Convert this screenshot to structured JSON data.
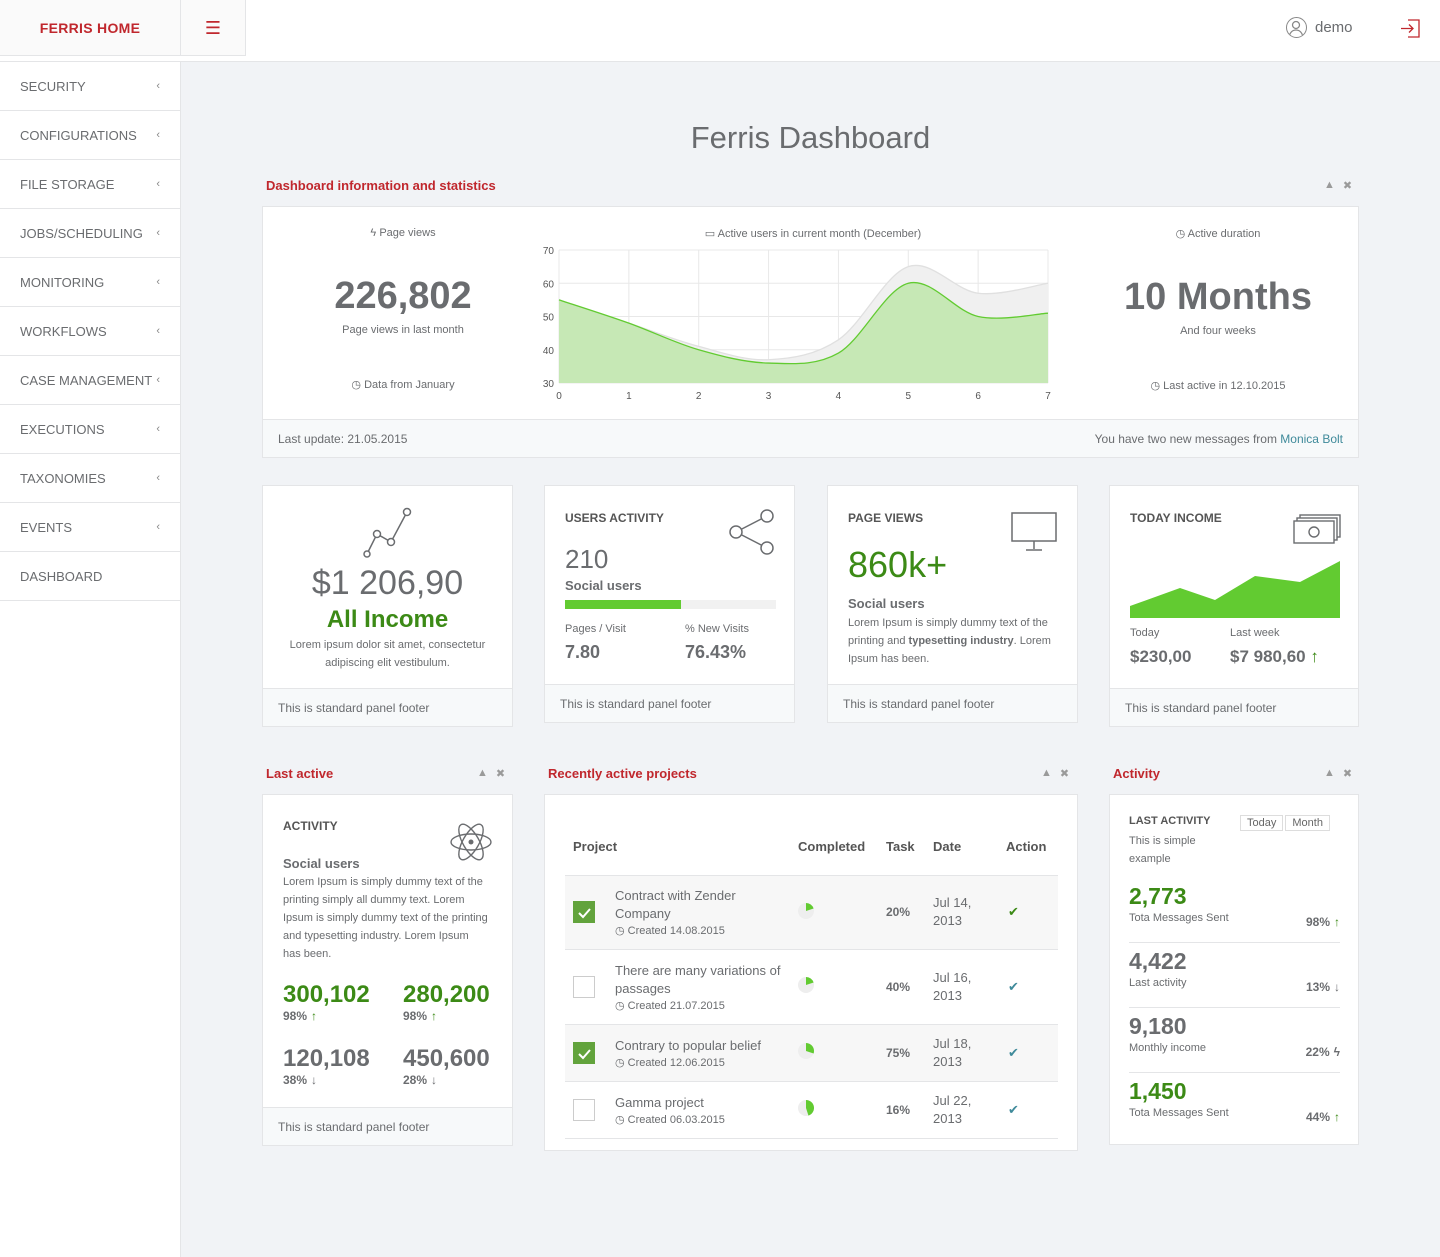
{
  "brand": "FERRIS HOME",
  "user": {
    "name": "demo"
  },
  "sidebar": {
    "items": [
      {
        "label": "SECURITY",
        "chevron": "‹"
      },
      {
        "label": "CONFIGURATIONS",
        "chevron": "‹"
      },
      {
        "label": "FILE STORAGE",
        "chevron": "‹"
      },
      {
        "label": "JOBS/SCHEDULING",
        "chevron": "‹"
      },
      {
        "label": "MONITORING",
        "chevron": "‹"
      },
      {
        "label": "WORKFLOWS",
        "chevron": "‹"
      },
      {
        "label": "CASE MANAGEMENT",
        "chevron": "‹"
      },
      {
        "label": "EXECUTIONS",
        "chevron": "‹"
      },
      {
        "label": "TAXONOMIES",
        "chevron": "‹"
      },
      {
        "label": "EVENTS",
        "chevron": "‹"
      },
      {
        "label": "DASHBOARD",
        "chevron": ""
      }
    ]
  },
  "page_title": "Ferris Dashboard",
  "stats": {
    "title": "Dashboard information and statistics",
    "page_views": {
      "heading": "Page views",
      "value": "226,802",
      "caption": "Page views in last month",
      "note": "Data from January"
    },
    "chart_heading": "Active users in current month (December)",
    "duration": {
      "heading": "Active duration",
      "value": "10 Months",
      "caption": "And four weeks",
      "note": "Last active in 12.10.2015"
    },
    "footer_left": "Last update: 21.05.2015",
    "footer_right": "You have two new messages from",
    "footer_link": "Monica Bolt"
  },
  "chart_data": {
    "type": "area",
    "x": [
      0,
      1,
      2,
      3,
      4,
      5,
      6,
      7
    ],
    "xlim": [
      0,
      7
    ],
    "ylim": [
      30,
      70
    ],
    "yticks": [
      30,
      40,
      50,
      60,
      70
    ],
    "grid": true,
    "series": [
      {
        "values": [
          55,
          48,
          41,
          37,
          43,
          65,
          57,
          60
        ],
        "color": "#f0f0f0"
      },
      {
        "values": [
          55,
          48,
          40,
          36,
          39,
          60,
          50,
          51
        ],
        "color": "#62cb31"
      }
    ]
  },
  "cards": {
    "income": {
      "value": "$1 206,90",
      "label": "All Income",
      "desc": "Lorem ipsum dolor sit amet, consectetur adipiscing elit vestibulum.",
      "footer": "This is standard panel footer"
    },
    "users_activity": {
      "title": "USERS ACTIVITY",
      "value": "210",
      "sub": "Social users",
      "progress": 0.55,
      "stat1_label": "Pages / Visit",
      "stat1_value": "7.80",
      "stat2_label": "% New Visits",
      "stat2_value": "76.43%",
      "footer": "This is standard panel footer"
    },
    "page_views": {
      "title": "PAGE VIEWS",
      "value": "860k+",
      "sub": "Social users",
      "desc1": "Lorem Ipsum is simply dummy text of the printing and ",
      "desc_bold": "typesetting industry",
      "desc2": ". Lorem Ipsum has been.",
      "footer": "This is standard panel footer"
    },
    "today_income": {
      "title": "TODAY INCOME",
      "today_label": "Today",
      "today_value": "$230,00",
      "week_label": "Last week",
      "week_value": "$7 980,60",
      "footer": "This is standard panel footer"
    }
  },
  "last_active": {
    "title": "Last active",
    "heading": "ACTIVITY",
    "sub": "Social users",
    "desc": "Lorem Ipsum is simply dummy text of the printing simply all dummy text. Lorem Ipsum is simply dummy text of the printing and typesetting industry. Lorem Ipsum has been.",
    "stats": [
      {
        "value": "300,102",
        "pct": "98%",
        "arrow": "↑",
        "color": "#3c8a16"
      },
      {
        "value": "280,200",
        "pct": "98%",
        "arrow": "↑",
        "color": "#3c8a16"
      },
      {
        "value": "120,108",
        "pct": "38%",
        "arrow": "↓",
        "color": "#6a6c6f"
      },
      {
        "value": "450,600",
        "pct": "28%",
        "arrow": "↓",
        "color": "#6a6c6f"
      }
    ],
    "footer": "This is standard panel footer"
  },
  "projects": {
    "title": "Recently active projects",
    "headers": [
      "Project",
      "Completed",
      "Task",
      "Date",
      "Action"
    ],
    "rows": [
      {
        "name": "Contract with Zender Company",
        "created": "Created 14.08.2015",
        "checked": true,
        "completed": 0.2,
        "task": "20%",
        "date": "Jul 14, 2013",
        "action_color": "#3c8a16"
      },
      {
        "name": "There are many variations of passages",
        "created": "Created 21.07.2015",
        "checked": false,
        "completed": 0.2,
        "task": "40%",
        "date": "Jul 16, 2013",
        "action_color": "#3f8a9a"
      },
      {
        "name": "Contrary to popular belief",
        "created": "Created 12.06.2015",
        "checked": true,
        "completed": 0.3,
        "task": "75%",
        "date": "Jul 18, 2013",
        "action_color": "#3f8a9a"
      },
      {
        "name": "Gamma project",
        "created": "Created 06.03.2015",
        "checked": false,
        "completed": 0.45,
        "task": "16%",
        "date": "Jul 22, 2013",
        "action_color": "#3f8a9a"
      }
    ]
  },
  "activity": {
    "title": "Activity",
    "heading": "LAST ACTIVITY",
    "sub": "This is simple example",
    "btn_today": "Today",
    "btn_month": "Month",
    "items": [
      {
        "value": "2,773",
        "label": "Tota Messages Sent",
        "pct": "98%",
        "arrow": "↑",
        "color": "#3c8a16"
      },
      {
        "value": "4,422",
        "label": "Last activity",
        "pct": "13%",
        "arrow": "↓",
        "color": "#6a6c6f"
      },
      {
        "value": "9,180",
        "label": "Monthly income",
        "pct": "22%",
        "arrow": "ϟ",
        "color": "#6a6c6f"
      },
      {
        "value": "1,450",
        "label": "Tota Messages Sent",
        "pct": "44%",
        "arrow": "↑",
        "color": "#3c8a16"
      }
    ]
  }
}
